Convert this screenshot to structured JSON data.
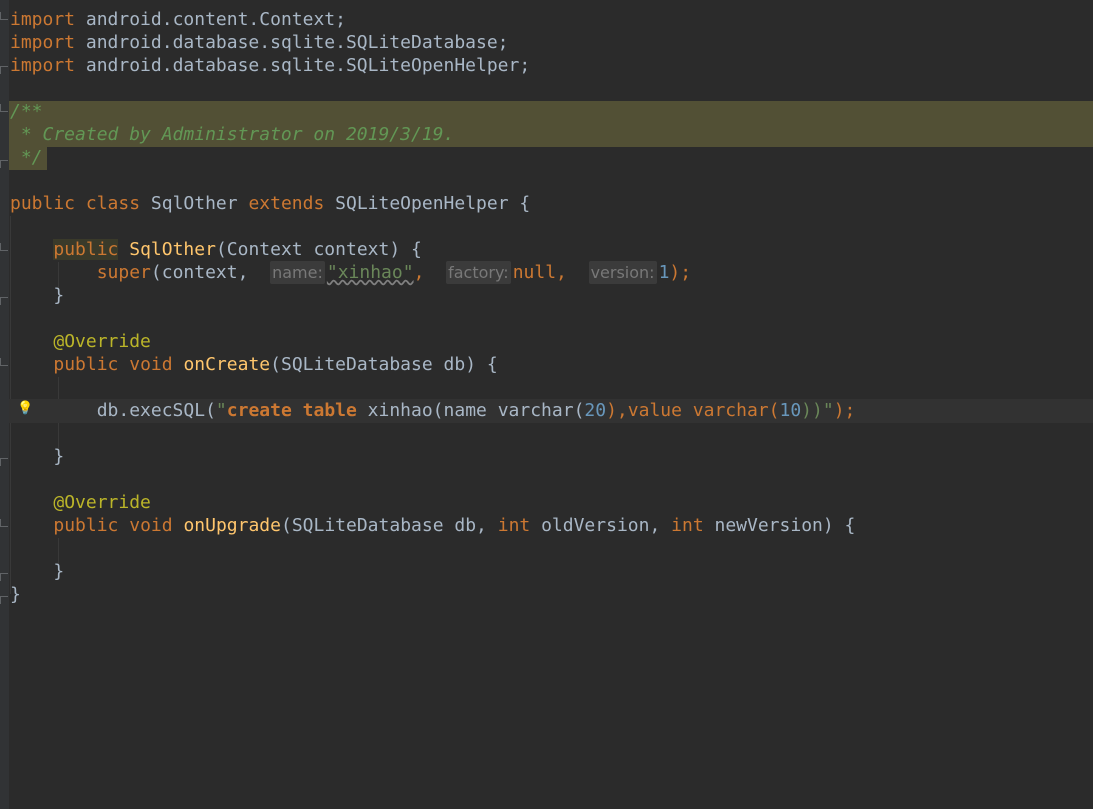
{
  "imports": [
    {
      "keyword": "import",
      "path": "android.content.Context;"
    },
    {
      "keyword": "import",
      "path": "android.database.sqlite.SQLiteDatabase;"
    },
    {
      "keyword": "import",
      "path": "android.database.sqlite.SQLiteOpenHelper;"
    }
  ],
  "doc_comment": {
    "open": "/**",
    "body": " * Created by Administrator on 2019/3/19.",
    "close": " */"
  },
  "class_decl": {
    "public": "public",
    "class": "class",
    "name": "SqlOther",
    "extends": "extends",
    "parent": "SQLiteOpenHelper",
    "brace": " {"
  },
  "constructor": {
    "public": "public",
    "name": "SqlOther",
    "params": "(Context context) {",
    "super_kw": "super",
    "super_open": "(context, ",
    "hint_name": "name:",
    "arg_name": "\"xinhao\"",
    "comma1": ", ",
    "hint_factory": "factory:",
    "arg_factory": "null",
    "comma2": ", ",
    "hint_version": "version:",
    "arg_version": "1",
    "super_close": ");",
    "close": "}"
  },
  "on_create": {
    "annotation": "@Override",
    "public": "public",
    "void": "void",
    "name": "onCreate",
    "params": "(SQLiteDatabase db) {",
    "call": "db.execSQL(",
    "str_open": "\"",
    "sql_create": "create",
    "sql_table": "table",
    "sql_rest1": " xinhao(name varchar(",
    "n20": "20",
    "sql_rest2": "),value varchar(",
    "n10": "10",
    "sql_rest3": "))\"",
    "end": ");",
    "close": "}"
  },
  "on_upgrade": {
    "annotation": "@Override",
    "public": "public",
    "void": "void",
    "name": "onUpgrade",
    "params_a": "(SQLiteDatabase db, ",
    "int1": "int",
    "p_old": " oldVersion, ",
    "int2": "int",
    "p_new": " newVersion) {",
    "close": "}"
  },
  "class_close": "}",
  "icons": {
    "intention": "lightbulb-icon"
  },
  "colors": {
    "background": "#2b2b2b",
    "keyword": "#cc7832",
    "string": "#6a8759",
    "number": "#6897bb",
    "method": "#ffc66d",
    "annotation": "#bbb529",
    "doc_comment": "#629755"
  }
}
